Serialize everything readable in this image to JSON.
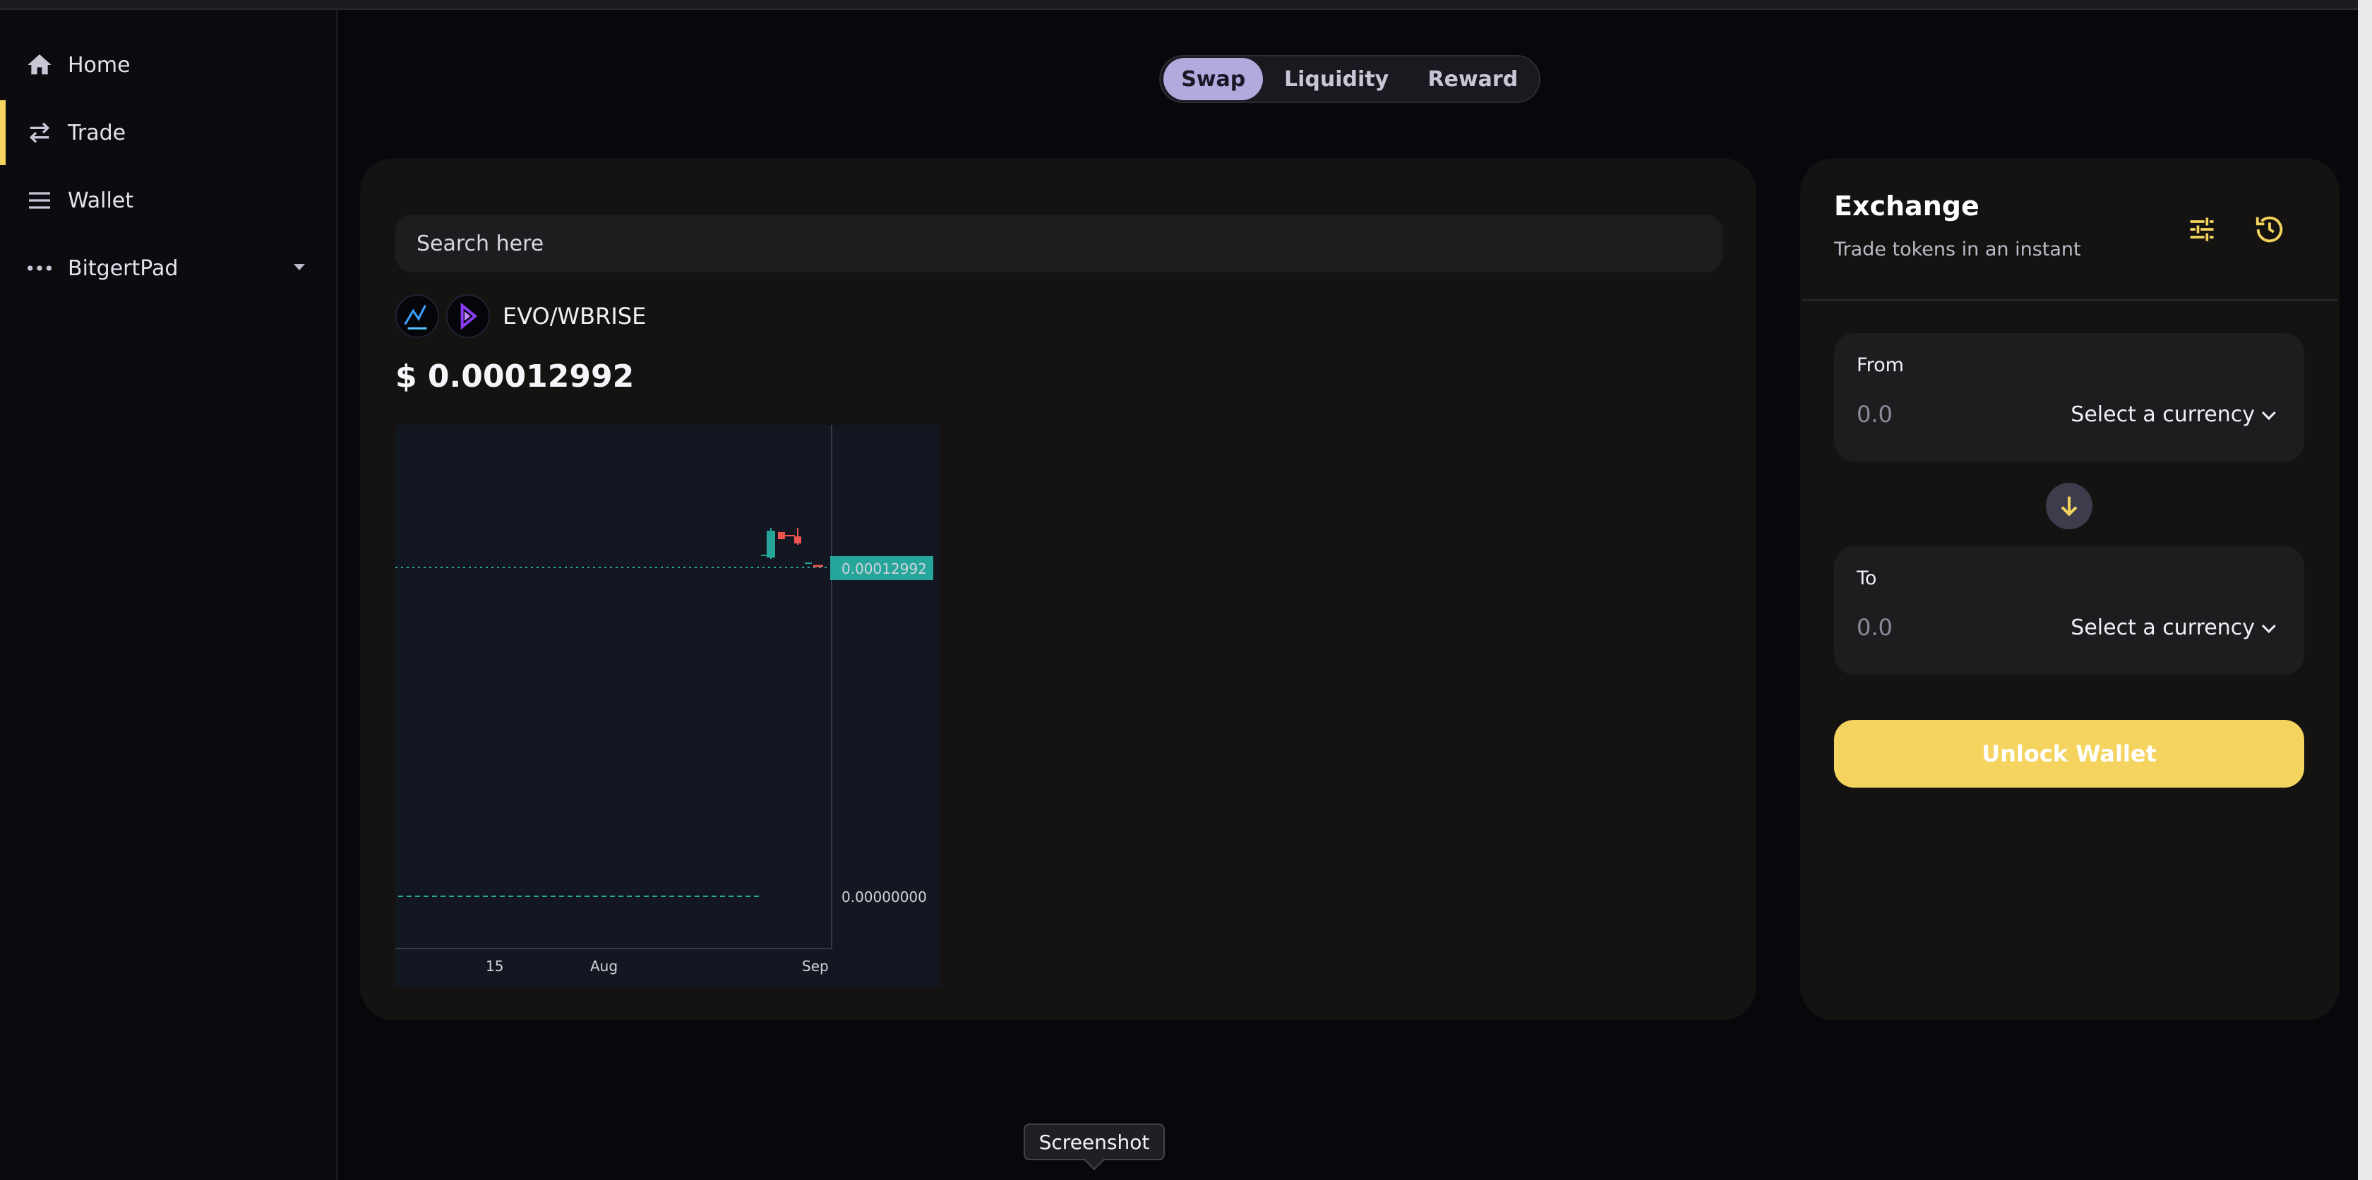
{
  "sidebar": {
    "items": [
      {
        "label": "Home",
        "icon": "home-icon"
      },
      {
        "label": "Trade",
        "icon": "swap-arrows-icon",
        "active": true
      },
      {
        "label": "Wallet",
        "icon": "menu-lines-icon"
      },
      {
        "label": "BitgertPad",
        "icon": "more-dots-icon",
        "has_caret": true
      }
    ]
  },
  "tabs": [
    "Swap",
    "Liquidity",
    "Reward"
  ],
  "selected_tab": "Swap",
  "chart_panel": {
    "search_placeholder": "Search here",
    "pair": "EVO/WBRISE",
    "price": "$ 0.00012992"
  },
  "chart_data": {
    "type": "candlestick",
    "title": "",
    "x_tick_labels": [
      "15",
      "Aug",
      "Sep"
    ],
    "price_labels": [
      "0.00012992",
      "0.00000000"
    ],
    "last_price": 0.00012992,
    "lines": [
      {
        "value": 0.00012992,
        "style": "dotted",
        "color": "#26a69a"
      },
      {
        "value": 0.0,
        "style": "dashed",
        "color": "#26a69a"
      }
    ],
    "colors": {
      "up": "#26a69a",
      "down": "#ef5350",
      "background": "#131722"
    }
  },
  "exchange": {
    "title": "Exchange",
    "subtitle": "Trade tokens in an instant",
    "from": {
      "label": "From",
      "value": "0.0",
      "select": "Select a currency"
    },
    "to": {
      "label": "To",
      "value": "0.0",
      "select": "Select a currency"
    },
    "unlock_label": "Unlock Wallet"
  },
  "tooltip": "Screenshot",
  "colors": {
    "accent": "#f4d35e",
    "tab_selected": "#b4a9dd",
    "panel": "#141311"
  }
}
